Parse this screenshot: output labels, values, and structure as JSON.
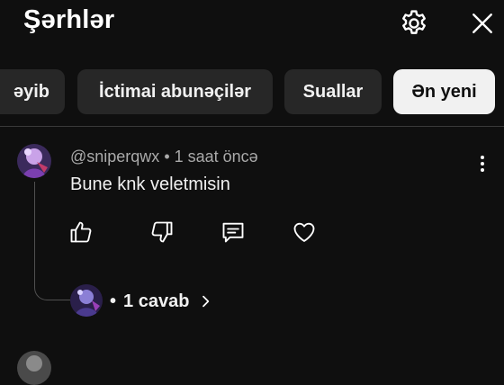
{
  "header": {
    "title": "Şərhlər"
  },
  "chips": [
    {
      "label": "əyib"
    },
    {
      "label": "İctimai abunəçilər"
    },
    {
      "label": "Suallar"
    },
    {
      "label": "Ən yeni"
    }
  ],
  "comment": {
    "author": "@sniperqwx",
    "separator": " • ",
    "time": "1 saat öncə",
    "text": "Bune knk veletmisin",
    "replies": {
      "dot": "•",
      "label": "1 cavab"
    }
  },
  "colors": {
    "background": "#0f0f0f",
    "chip": "#272727",
    "chip_active": "#f1f1f1",
    "meta": "#aaaaaa"
  }
}
